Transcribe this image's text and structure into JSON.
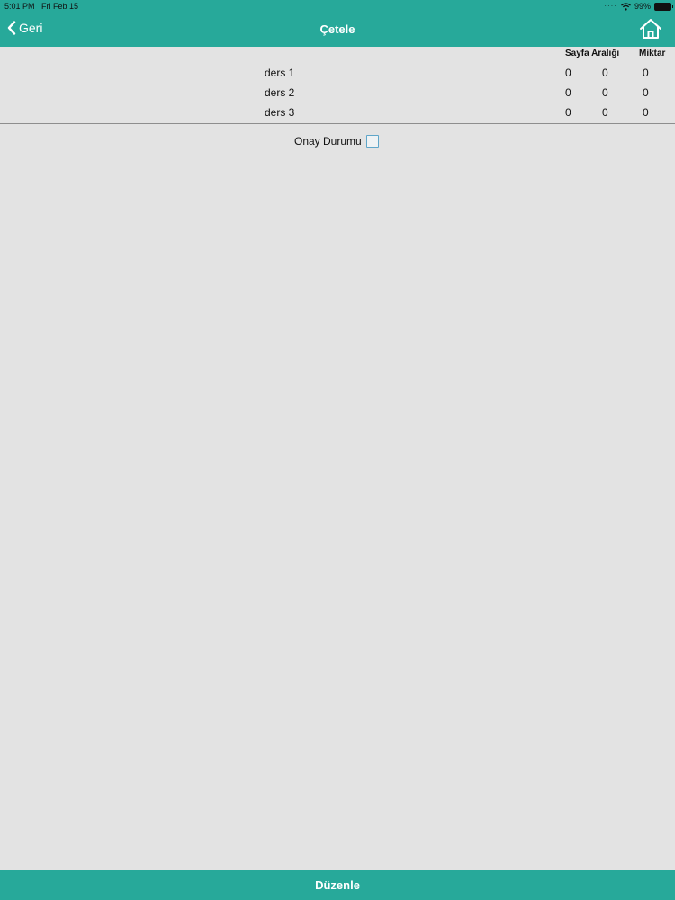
{
  "status_bar": {
    "time": "5:01 PM",
    "date": "Fri Feb 15",
    "battery": "99%"
  },
  "nav": {
    "back_label": "Geri",
    "title": "Çetele"
  },
  "table": {
    "headers": [
      "Sayfa Aralığı",
      "Miktar"
    ],
    "rows": [
      {
        "name": "ders 1",
        "v1": "0",
        "v2": "0",
        "v3": "0"
      },
      {
        "name": "ders 2",
        "v1": "0",
        "v2": "0",
        "v3": "0"
      },
      {
        "name": "ders 3",
        "v1": "0",
        "v2": "0",
        "v3": "0"
      }
    ]
  },
  "approval": {
    "label": "Onay Durumu",
    "checked": false
  },
  "bottom": {
    "edit_label": "Düzenle"
  },
  "colors": {
    "accent": "#27a99a",
    "background": "#e3e3e3"
  }
}
